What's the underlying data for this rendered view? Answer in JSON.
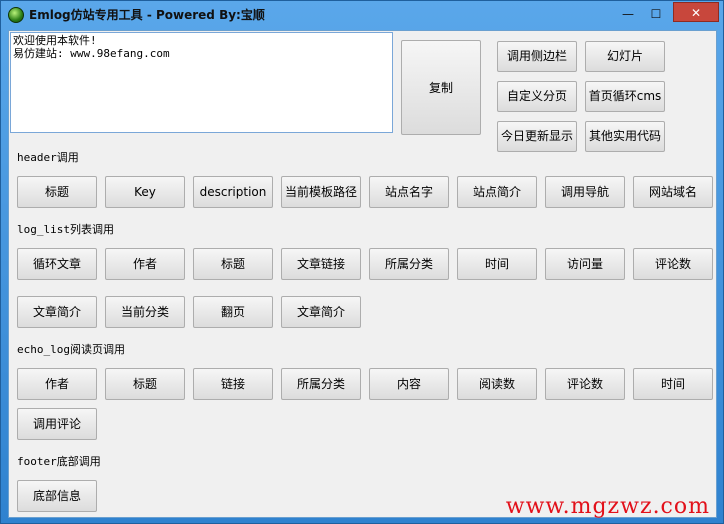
{
  "window": {
    "title": "Emlog仿站专用工具 - Powered By:宝顺",
    "minimize_glyph": "—",
    "maximize_glyph": "☐",
    "close_glyph": "✕"
  },
  "editor": {
    "value": "欢迎使用本软件!\n易仿建站: www.98efang.com"
  },
  "copy_button": "复制",
  "right_buttons": [
    "调用侧边栏",
    "幻灯片",
    "自定义分页",
    "首页循环cms",
    "今日更新显示",
    "其他实用代码"
  ],
  "sections": {
    "header": {
      "label": "header调用",
      "buttons": [
        "标题",
        "Key",
        "description",
        "当前模板路径",
        "站点名字",
        "站点简介",
        "调用导航",
        "网站域名"
      ]
    },
    "log_list": {
      "label": "log_list列表调用",
      "buttons": [
        "循环文章",
        "作者",
        "标题",
        "文章链接",
        "所属分类",
        "时间",
        "访问量",
        "评论数",
        "文章简介",
        "当前分类",
        "翻页",
        "文章简介"
      ]
    },
    "echo_log": {
      "label": "echo_log阅读页调用",
      "buttons": [
        "作者",
        "标题",
        "链接",
        "所属分类",
        "内容",
        "阅读数",
        "评论数",
        "时间",
        "调用评论"
      ]
    },
    "footer": {
      "label": "footer底部调用",
      "buttons": [
        "底部信息"
      ]
    }
  },
  "watermark": "www.mgzwz.com"
}
